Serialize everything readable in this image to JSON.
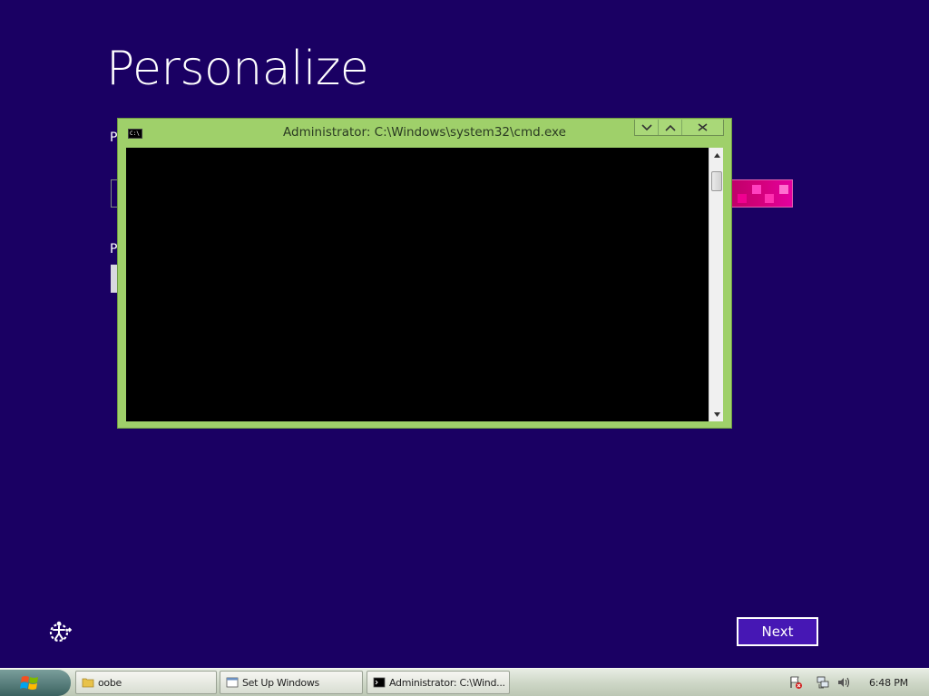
{
  "oobe": {
    "title": "Personalize",
    "label_1": "P",
    "label_2": "P",
    "next_label": "Next"
  },
  "cmd_window": {
    "title": "Administrator: C:\\Windows\\system32\\cmd.exe",
    "icon_text": "C:\\",
    "console_text": ""
  },
  "taskbar": {
    "start_icon": "windows-flag-icon",
    "tasks": [
      {
        "label": "oobe",
        "icon": "folder-icon"
      },
      {
        "label": "Set Up Windows",
        "icon": "window-icon"
      },
      {
        "label": "Administrator: C:\\Wind...",
        "icon": "cmd-icon"
      }
    ],
    "tray_icons": [
      "action-center-flag-icon",
      "network-icon",
      "volume-icon"
    ],
    "clock": "6:48 PM"
  },
  "colors": {
    "oobe_background": "#1a0063",
    "cmd_frame": "#9fd06a",
    "next_button": "#4617b4",
    "accent_swatch": "#d5007d"
  }
}
